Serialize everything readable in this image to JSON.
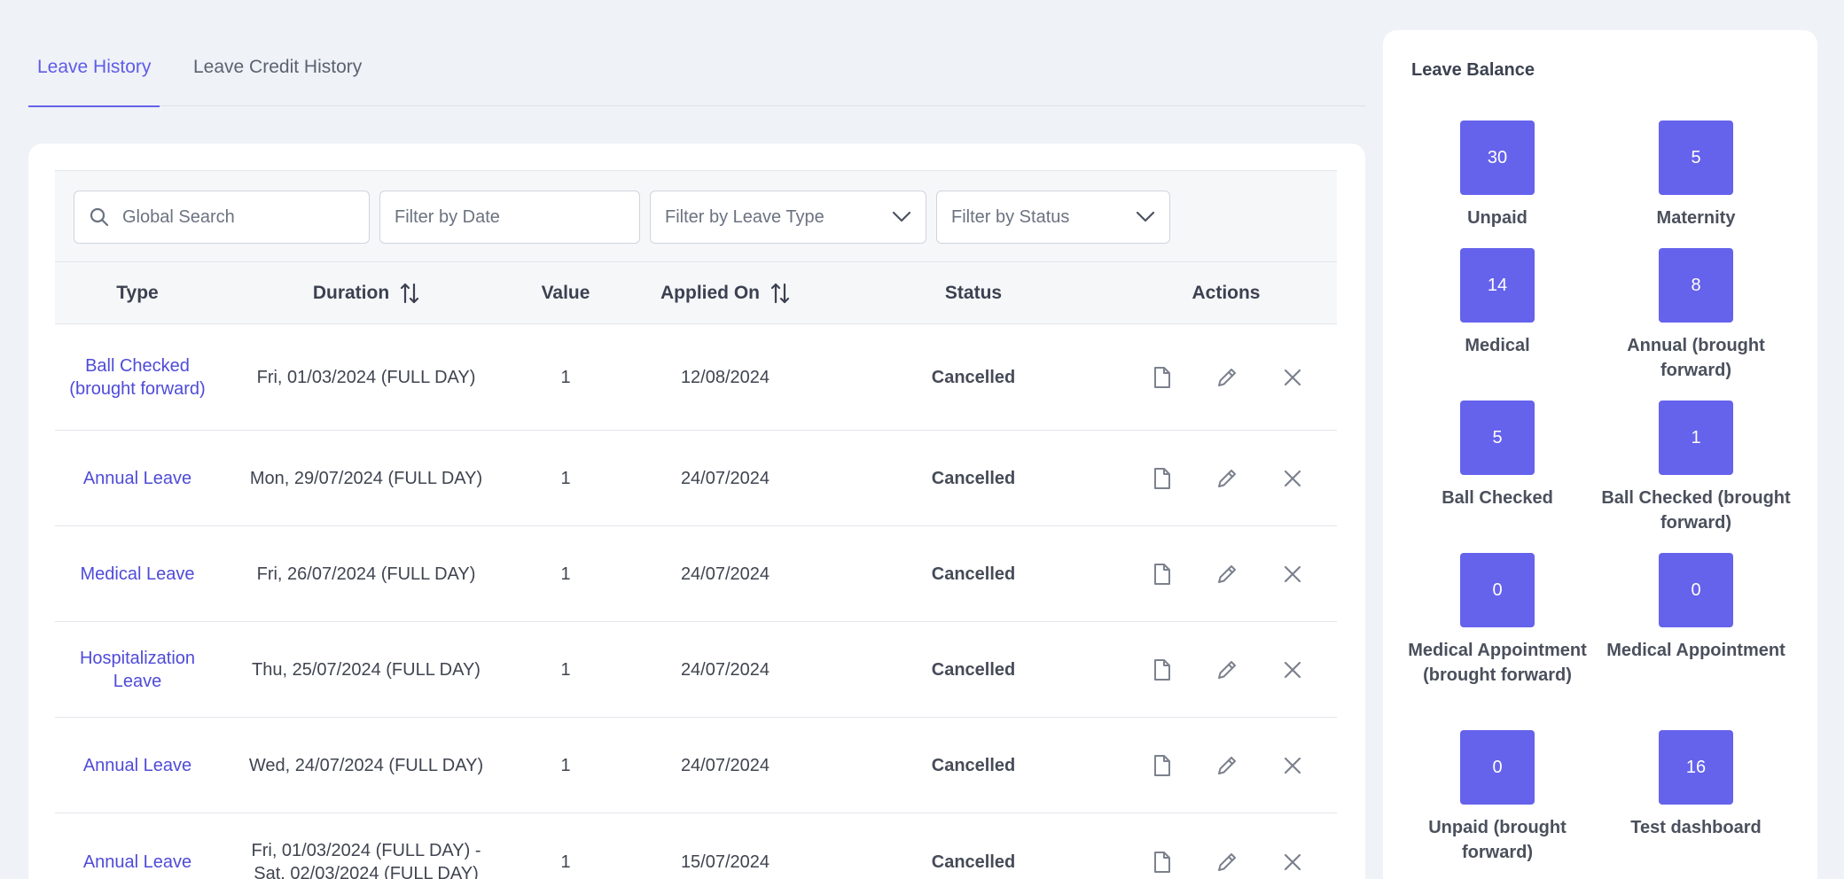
{
  "tabs": [
    {
      "label": "Leave History",
      "active": true
    },
    {
      "label": "Leave Credit History",
      "active": false
    }
  ],
  "filters": {
    "search_placeholder": "Global Search",
    "date_placeholder": "Filter by Date",
    "leave_type_placeholder": "Filter by Leave Type",
    "status_placeholder": "Filter by Status"
  },
  "table": {
    "headers": {
      "type": "Type",
      "duration": "Duration",
      "value": "Value",
      "applied_on": "Applied On",
      "status": "Status",
      "actions": "Actions"
    },
    "rows": [
      {
        "type": "Ball Checked (brought forward)",
        "duration": "Fri, 01/03/2024 (FULL DAY)",
        "value": "1",
        "applied_on": "12/08/2024",
        "status": "Cancelled"
      },
      {
        "type": "Annual Leave",
        "duration": "Mon, 29/07/2024 (FULL DAY)",
        "value": "1",
        "applied_on": "24/07/2024",
        "status": "Cancelled"
      },
      {
        "type": "Medical Leave",
        "duration": "Fri, 26/07/2024 (FULL DAY)",
        "value": "1",
        "applied_on": "24/07/2024",
        "status": "Cancelled"
      },
      {
        "type": "Hospitalization Leave",
        "duration": "Thu, 25/07/2024 (FULL DAY)",
        "value": "1",
        "applied_on": "24/07/2024",
        "status": "Cancelled"
      },
      {
        "type": "Annual Leave",
        "duration": "Wed, 24/07/2024 (FULL DAY)",
        "value": "1",
        "applied_on": "24/07/2024",
        "status": "Cancelled"
      },
      {
        "type": "Annual Leave",
        "duration": "Fri, 01/03/2024 (FULL DAY) - Sat, 02/03/2024 (FULL DAY)",
        "value": "1",
        "applied_on": "15/07/2024",
        "status": "Cancelled"
      }
    ]
  },
  "balance": {
    "title": "Leave Balance",
    "items": [
      {
        "value": "30",
        "label": "Unpaid"
      },
      {
        "value": "5",
        "label": "Maternity"
      },
      {
        "value": "14",
        "label": "Medical"
      },
      {
        "value": "8",
        "label": "Annual (brought forward)"
      },
      {
        "value": "5",
        "label": "Ball Checked"
      },
      {
        "value": "1",
        "label": "Ball Checked (brought forward)"
      },
      {
        "value": "0",
        "label": "Medical Appointment (brought forward)"
      },
      {
        "value": "0",
        "label": "Medical Appointment"
      },
      {
        "value": "0",
        "label": "Unpaid (brought forward)"
      },
      {
        "value": "16",
        "label": "Test dashboard"
      }
    ]
  },
  "colors": {
    "accent": "#6562ea",
    "link": "#4f4bd8",
    "balance_box": "#6562ec",
    "background": "#eff2f7"
  }
}
